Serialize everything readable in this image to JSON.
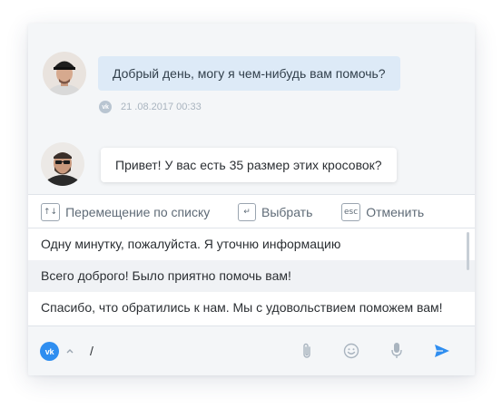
{
  "chat": {
    "operator_message": "Добрый день, могу я чем-нибудь вам помочь?",
    "operator_channel_icon": "vk-icon",
    "operator_timestamp": "21 .08.2017 00:33",
    "client_message": "Привет! У вас есть 35 размер этих кросовок?"
  },
  "hints": [
    {
      "key": "↑↓",
      "label": "Перемещение по списку"
    },
    {
      "key": "↵",
      "label": "Выбрать"
    },
    {
      "key": "esc",
      "label": "Отменить"
    }
  ],
  "suggestions": [
    "Одну минутку, пожалуйста. Я уточню информацию",
    "Всего доброго! Было приятно помочь вам!",
    "Спасибо, что обратились к нам. Мы с удовольствием поможем вам!"
  ],
  "composer": {
    "channel_label": "vk",
    "input_value": "/",
    "icons": [
      "paperclip-icon",
      "smile-icon",
      "microphone-icon",
      "send-icon"
    ]
  },
  "colors": {
    "accent": "#2f8ef0",
    "operator_bubble": "#ddeaf7",
    "background": "#f4f6f8"
  }
}
